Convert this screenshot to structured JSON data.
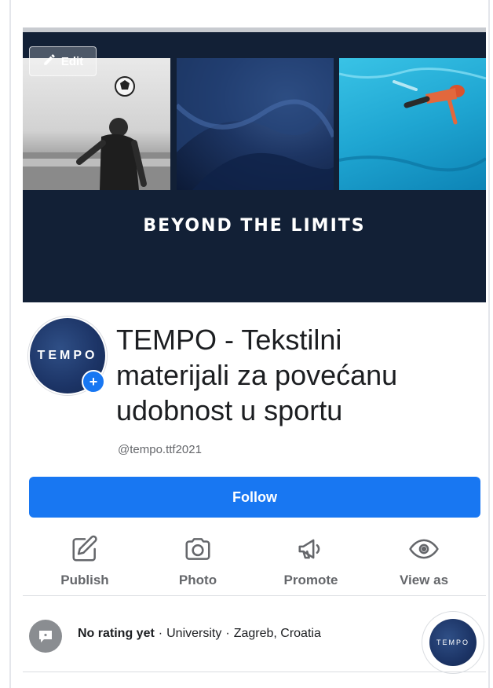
{
  "cover": {
    "title": "BEYOND THE LIMITS",
    "edit_label": "Edit",
    "photos": [
      "photo-soccer",
      "photo-fabric",
      "photo-swimmer"
    ]
  },
  "profile": {
    "avatar_text": "TEMPO",
    "name": "TEMPO - Tekstilni materijali za povećanu udobnost u sportu",
    "handle": "@tempo.ttf2021"
  },
  "follow_label": "Follow",
  "actions": [
    {
      "label": "Publish",
      "icon": "edit-square-icon"
    },
    {
      "label": "Photo",
      "icon": "camera-icon"
    },
    {
      "label": "Promote",
      "icon": "megaphone-icon"
    },
    {
      "label": "View as",
      "icon": "eye-icon"
    }
  ],
  "info": {
    "rating": "No rating yet",
    "category": "University",
    "location": "Zagreb, Croatia",
    "mini_avatar_text": "TEMPO"
  },
  "colors": {
    "accent": "#1877f2",
    "cover_bg": "#122036"
  }
}
